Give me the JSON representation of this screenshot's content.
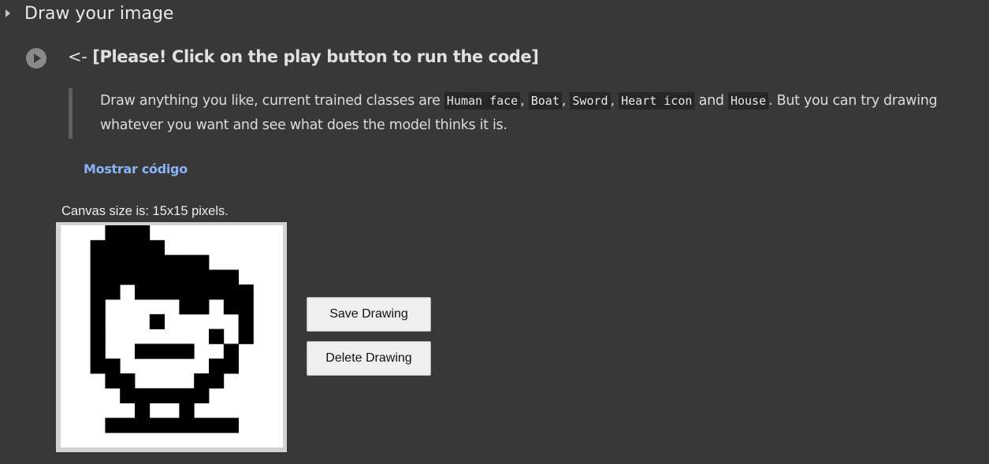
{
  "section": {
    "title": "Draw your image"
  },
  "cell": {
    "title_arrow": "<-",
    "title_text": "[Please! Click on the play button to run the code]"
  },
  "description": {
    "part1": "Draw anything you like, current trained classes are ",
    "classes": [
      "Human face",
      "Boat",
      "Sword",
      "Heart icon",
      "House"
    ],
    "sep": ", ",
    "and": " and ",
    "part2": ". But you can try drawing whatever you want and see what does the model thinks it is."
  },
  "show_code": {
    "label": "Mostrar código"
  },
  "canvas": {
    "label": "Canvas size is: 15x15 pixels.",
    "grid_size": 15,
    "pixels": [
      "000111000000000",
      "001111100000000",
      "001111111100000",
      "001111111111000",
      "001101111111100",
      "001000001101100",
      "001000100000100",
      "001000000010100",
      "001001111001000",
      "001100000011000",
      "000110000110000",
      "000011111100000",
      "000001001000000",
      "000111111111000",
      "000000000000000"
    ]
  },
  "buttons": {
    "save_label": "Save Drawing",
    "delete_label": "Delete Drawing"
  },
  "colors": {
    "background": "#383838",
    "link": "#8ab4f8",
    "ink": "#000000",
    "canvas_bg": "#ffffff"
  }
}
